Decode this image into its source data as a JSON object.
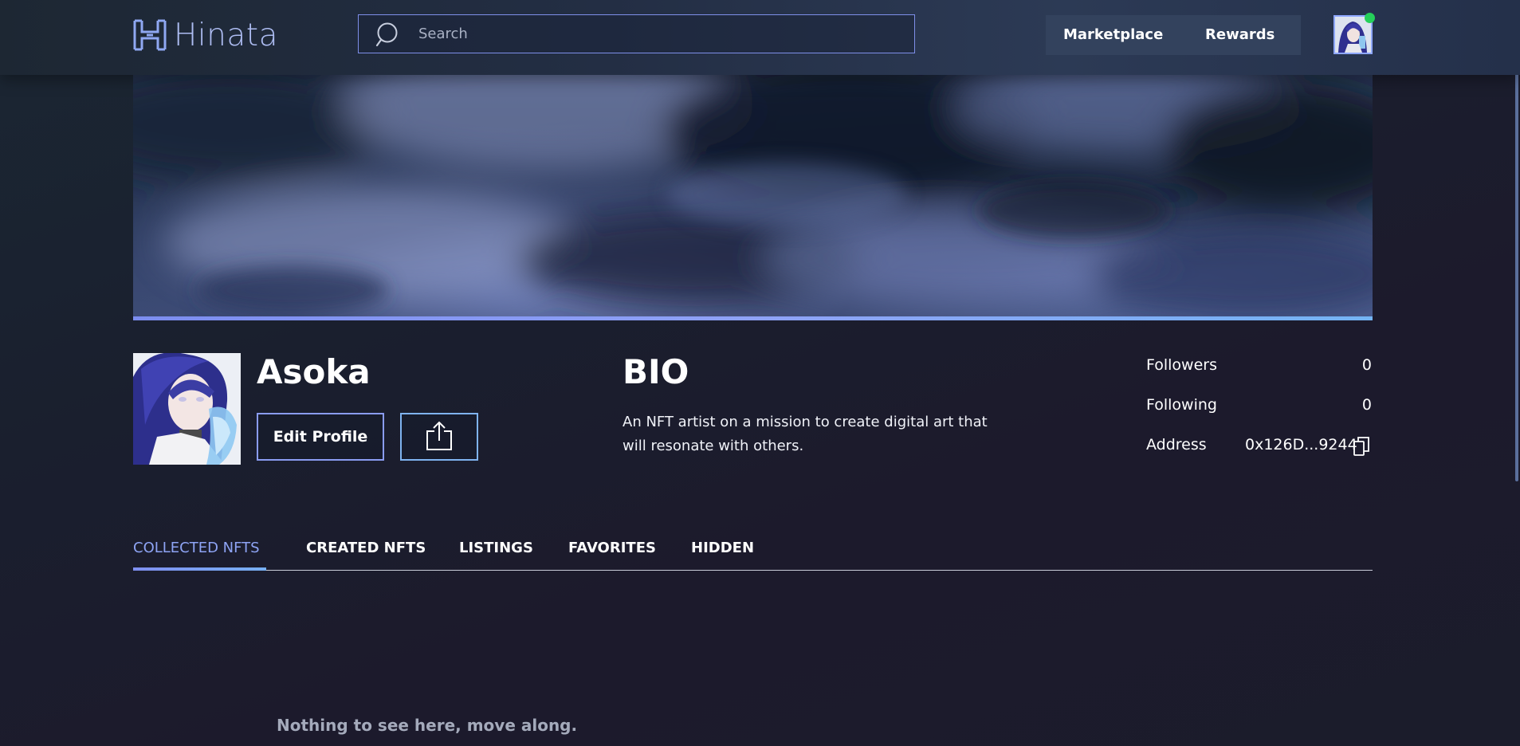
{
  "header": {
    "logo_text": "Hinata",
    "search": {
      "placeholder": "Search",
      "value": ""
    },
    "nav": [
      {
        "label": "Marketplace"
      },
      {
        "label": "Rewards"
      }
    ],
    "online_status_color": "#25d05a"
  },
  "colors": {
    "accent": "#8ea4f4",
    "accent_blue": "#77b0f3",
    "background": "#1b1c2b"
  },
  "profile": {
    "username": "Asoka",
    "edit_button_label": "Edit Profile",
    "share_icon": "share-icon",
    "bio_heading": "BIO",
    "bio_text": "An NFT artist on a mission to create digital art that will resonate with others.",
    "stats": [
      {
        "label": "Followers",
        "value": "0"
      },
      {
        "label": "Following",
        "value": "0"
      },
      {
        "label": "Address",
        "value": "0x126D...9244"
      }
    ]
  },
  "tabs": {
    "items": [
      {
        "label": "COLLECTED NFTS",
        "active": true
      },
      {
        "label": "CREATED NFTS",
        "active": false
      },
      {
        "label": "LISTINGS",
        "active": false
      },
      {
        "label": "FAVORITES",
        "active": false
      },
      {
        "label": "HIDDEN",
        "active": false
      }
    ]
  },
  "content": {
    "empty_message": "Nothing to see here, move along."
  }
}
